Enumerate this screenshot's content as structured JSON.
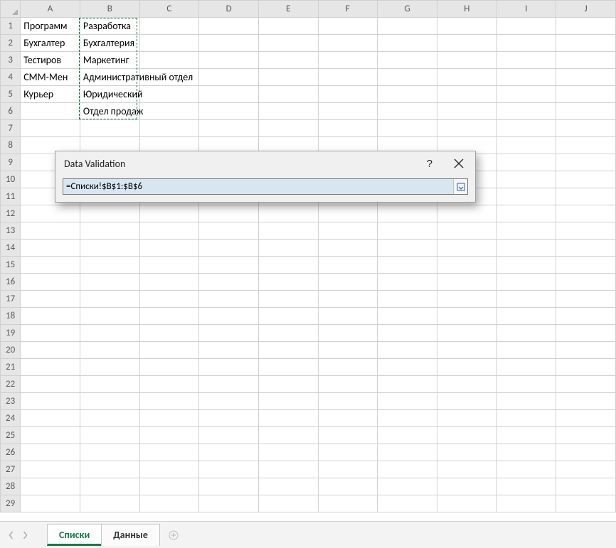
{
  "columns": [
    "A",
    "B",
    "C",
    "D",
    "E",
    "F",
    "G",
    "H",
    "I",
    "J"
  ],
  "rows": 29,
  "cells": {
    "A1": "Программист",
    "A2": "Бухгалтер",
    "A3": "Тестировщик",
    "A4": "СММ-Менеджер",
    "A5": "Курьер",
    "B1": "Разработка",
    "B2": "Бухгалтерия",
    "B3": "Маркетинг",
    "B4": "Административный отдел",
    "B5": "Юридический",
    "B6": "Отдел продаж"
  },
  "cellsTruncated": {
    "A1": "Программ",
    "A2": "Бухгалтер",
    "A3": "Тестиров",
    "A4": "СММ-Мен",
    "A5": "Курьер"
  },
  "selection": {
    "range": "B1:B6"
  },
  "dialog": {
    "title": "Data Validation",
    "formula": "=Списки!$B$1:$B$6"
  },
  "tabs": {
    "items": [
      "Списки",
      "Данные"
    ],
    "active": 0
  }
}
